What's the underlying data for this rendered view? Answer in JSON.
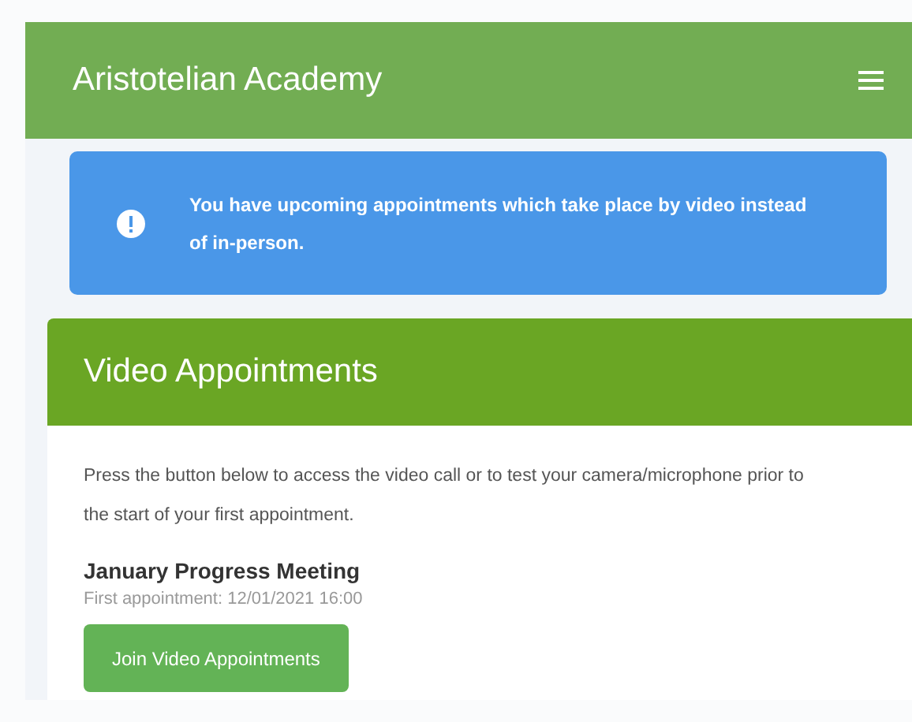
{
  "header": {
    "title": "Aristotelian Academy"
  },
  "alert": {
    "text": "You have upcoming appointments which take place by video instead of in-person."
  },
  "card": {
    "title": "Video Appointments",
    "intro": "Press the button below to access the video call or to test your camera/microphone prior to the start of your first appointment.",
    "event": {
      "title": "January Progress Meeting",
      "detail": "First appointment: 12/01/2021 16:00"
    },
    "button": "Join Video Appointments"
  }
}
